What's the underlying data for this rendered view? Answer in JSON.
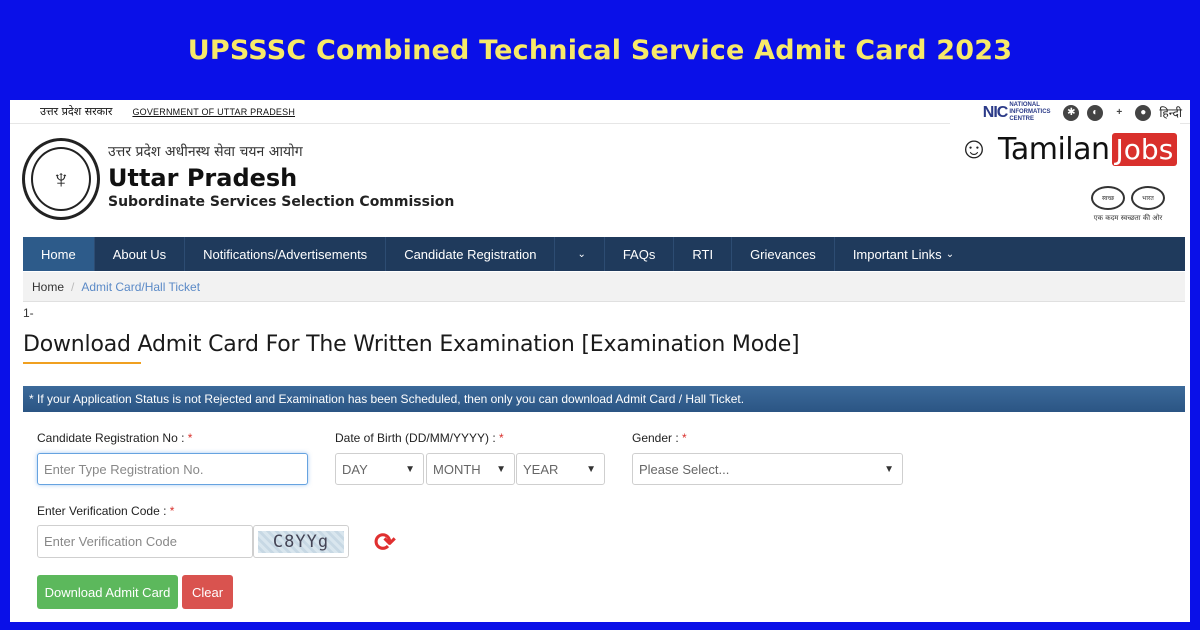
{
  "banner": {
    "title": "UPSSSC Combined Technical Service Admit Card 2023"
  },
  "topbar": {
    "hindi_gov": "उत्तर प्रदेश सरकार",
    "gov_link": "GOVERNMENT OF UTTAR PRADESH",
    "nic_logo": "NIC",
    "nic_sub": "NATIONAL INFORMATICS CENTRE",
    "icons": [
      "sitemap-icon",
      "accessibility-icon",
      "font-size-icon",
      "user-icon"
    ],
    "language_link": "हिन्दी"
  },
  "header": {
    "org_hindi": "उत्तर प्रदेश अधीनस्थ सेवा चयन आयोग",
    "org_name": "Uttar Pradesh",
    "org_sub": "Subordinate Services Selection Commission",
    "brand_tamilan": "Tamilan",
    "brand_jobs": "Jobs",
    "swachh_left": "स्वच्छ",
    "swachh_right": "भारत",
    "swachh_tagline": "एक कदम स्वच्छता की ओर"
  },
  "nav": {
    "items": [
      {
        "label": "Home",
        "active": true
      },
      {
        "label": "About Us"
      },
      {
        "label": "Notifications/Advertisements"
      },
      {
        "label": "Candidate Registration"
      },
      {
        "label": ""
      },
      {
        "label": "FAQs"
      },
      {
        "label": "RTI"
      },
      {
        "label": "Grievances"
      },
      {
        "label": "Important Links"
      }
    ],
    "caret": "⌄"
  },
  "breadcrumb": {
    "home": "Home",
    "separator": "/",
    "current": "Admit Card/Hall Ticket"
  },
  "main": {
    "number": "1-",
    "title": "Download Admit Card For The Written Examination [Examination Mode]",
    "notice": "* If your Application Status is not Rejected and Examination has been Scheduled, then only you can download Admit Card / Hall Ticket."
  },
  "form": {
    "reg_label": "Candidate Registration No : ",
    "reg_placeholder": "Enter Type Registration No.",
    "dob_label": "Date of Birth (DD/MM/YYYY) : ",
    "day": "DAY",
    "month": "MONTH",
    "year": "YEAR",
    "gender_label": "Gender : ",
    "gender_value": "Please Select...",
    "verify_label": "Enter Verification Code : ",
    "verify_placeholder": "Enter Verification Code",
    "captcha_text": "C8YYg",
    "required_mark": "*",
    "download_button": "Download Admit Card",
    "clear_button": "Clear"
  }
}
